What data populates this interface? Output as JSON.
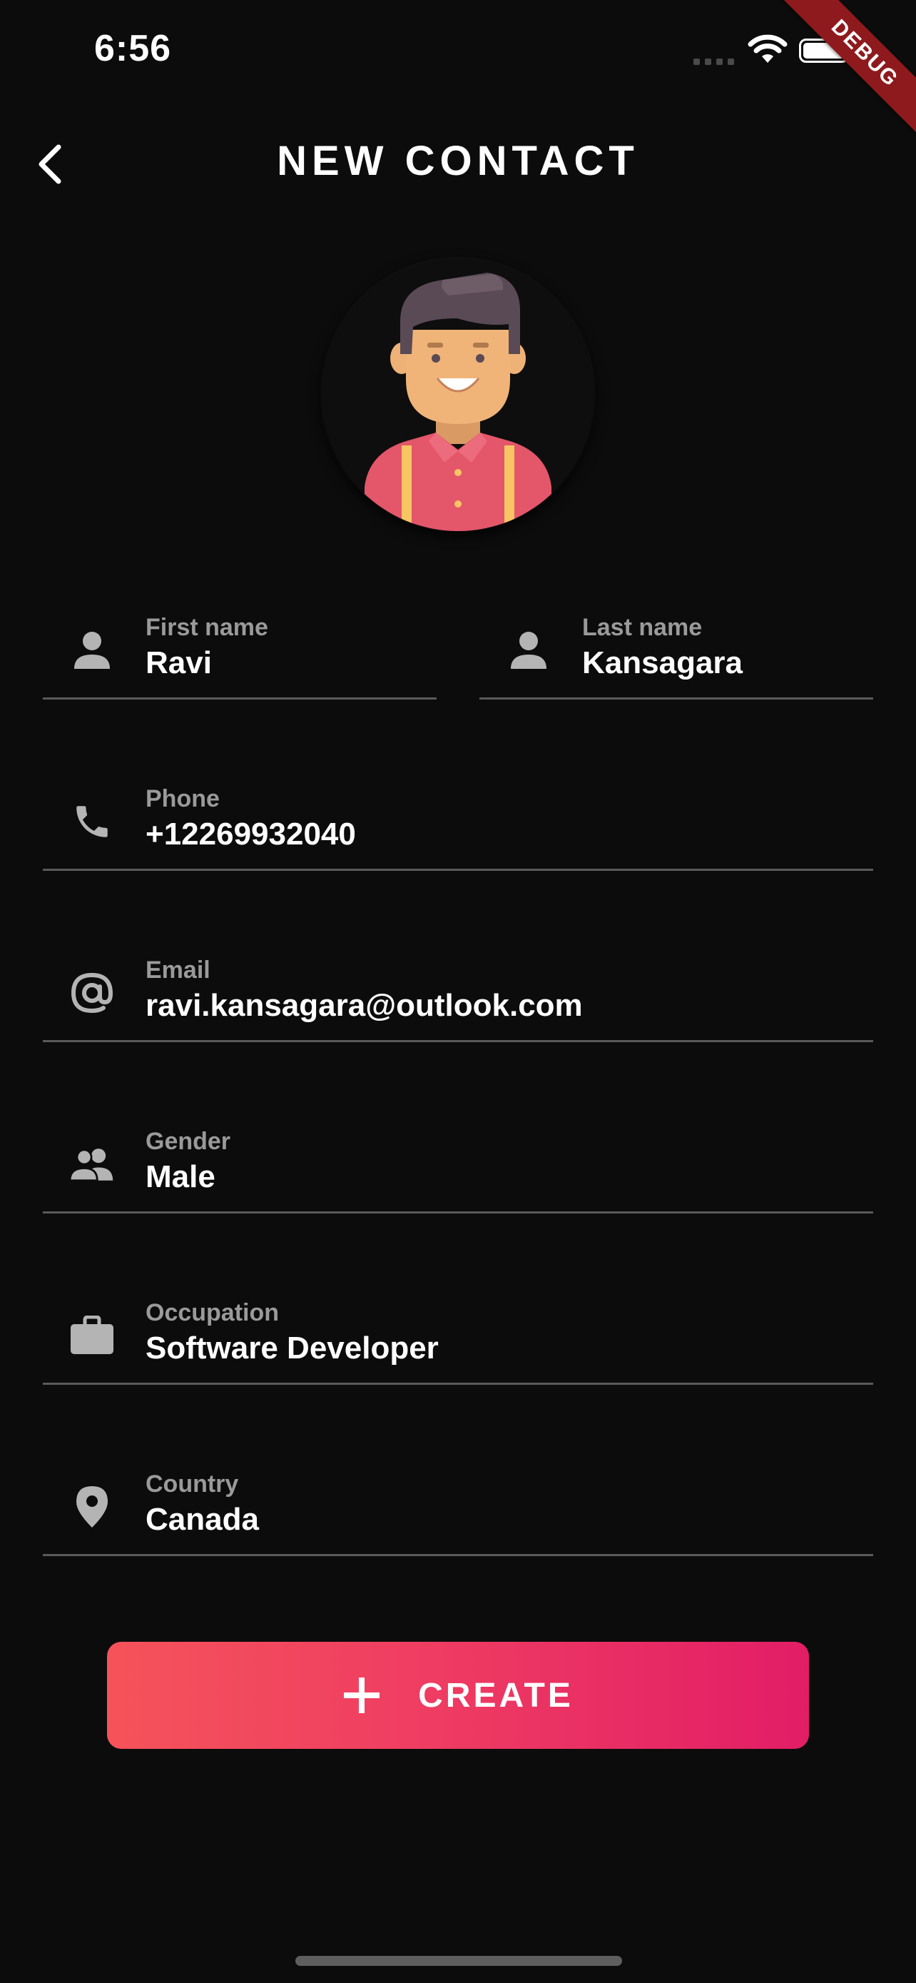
{
  "status_bar": {
    "time": "6:56",
    "debug_label": "DEBUG"
  },
  "app_bar": {
    "title": "NEW CONTACT",
    "back_icon": "chevron-left-icon"
  },
  "avatar": {
    "icon": "male-avatar-illustration"
  },
  "form": {
    "first_name": {
      "label": "First name",
      "value": "Ravi",
      "icon": "person-icon"
    },
    "last_name": {
      "label": "Last name",
      "value": "Kansagara",
      "icon": "person-icon"
    },
    "phone": {
      "label": "Phone",
      "value": "+12269932040",
      "icon": "phone-icon"
    },
    "email": {
      "label": "Email",
      "value": "ravi.kansagara@outlook.com",
      "icon": "at-icon"
    },
    "gender": {
      "label": "Gender",
      "value": "Male",
      "icon": "people-icon"
    },
    "occupation": {
      "label": "Occupation",
      "value": "Software Developer",
      "icon": "briefcase-icon"
    },
    "country": {
      "label": "Country",
      "value": "Canada",
      "icon": "location-pin-icon"
    }
  },
  "actions": {
    "create_label": "CREATE",
    "create_icon": "plus-icon"
  },
  "colors": {
    "background": "#0c0c0c",
    "divider": "#5a5a5a",
    "label": "#9a9a9a",
    "icon": "#b4b4b4",
    "button_gradient_start": "#f5535a",
    "button_gradient_end": "#e21d66",
    "debug_ribbon": "#8e1a1e"
  }
}
